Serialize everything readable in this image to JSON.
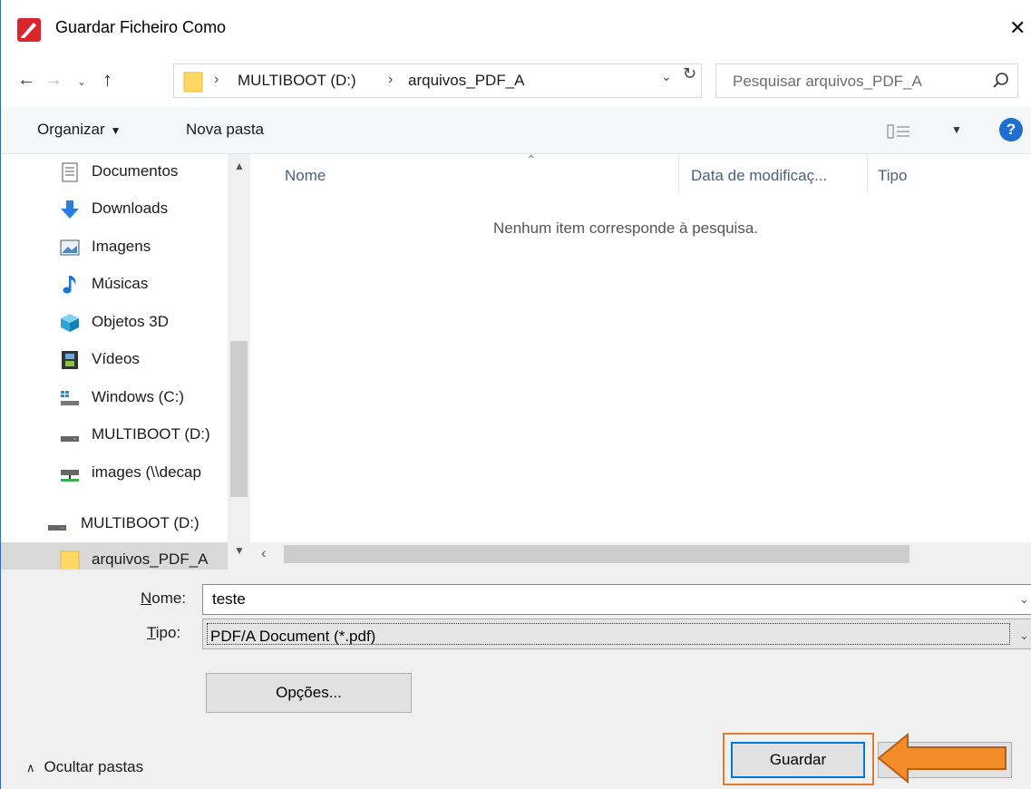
{
  "window": {
    "title": "Guardar Ficheiro Como"
  },
  "address_bar": {
    "segments": [
      "MULTIBOOT (D:)",
      "arquivos_PDF_A"
    ],
    "search_placeholder": "Pesquisar arquivos_PDF_A"
  },
  "toolbar": {
    "organize_label": "Organizar",
    "new_folder_label": "Nova pasta"
  },
  "sidebar": {
    "items": [
      {
        "label": "Documentos",
        "icon": "documents-icon"
      },
      {
        "label": "Downloads",
        "icon": "download-arrow-icon"
      },
      {
        "label": "Imagens",
        "icon": "pictures-icon"
      },
      {
        "label": "Músicas",
        "icon": "music-note-icon"
      },
      {
        "label": "Objetos 3D",
        "icon": "cube-3d-icon"
      },
      {
        "label": "Vídeos",
        "icon": "film-icon"
      },
      {
        "label": "Windows (C:)",
        "icon": "windows-drive-icon"
      },
      {
        "label": "MULTIBOOT (D:)",
        "icon": "drive-icon"
      },
      {
        "label": "images (\\\\decap",
        "icon": "network-drive-icon"
      },
      {
        "label": "MULTIBOOT (D:)",
        "icon": "drive-icon"
      },
      {
        "label": "arquivos_PDF_A",
        "icon": "folder-icon",
        "selected": true
      }
    ]
  },
  "file_list": {
    "columns": [
      "Nome",
      "Data de modificaç...",
      "Tipo"
    ],
    "empty_message": "Nenhum item corresponde à pesquisa."
  },
  "form": {
    "name_label_ul": "N",
    "name_label_rest": "ome:",
    "name_value": "teste",
    "type_label_ul": "T",
    "type_label_rest": "ipo:",
    "type_value": "PDF/A Document (*.pdf)",
    "options_label": "Opções...",
    "hide_folders_label": "Ocultar pastas",
    "save_label": "Guardar"
  },
  "colors": {
    "accent": "#0078d7",
    "highlight": "#e27b2e",
    "arrow_fill": "#f28c28",
    "help": "#1f6fd0"
  }
}
